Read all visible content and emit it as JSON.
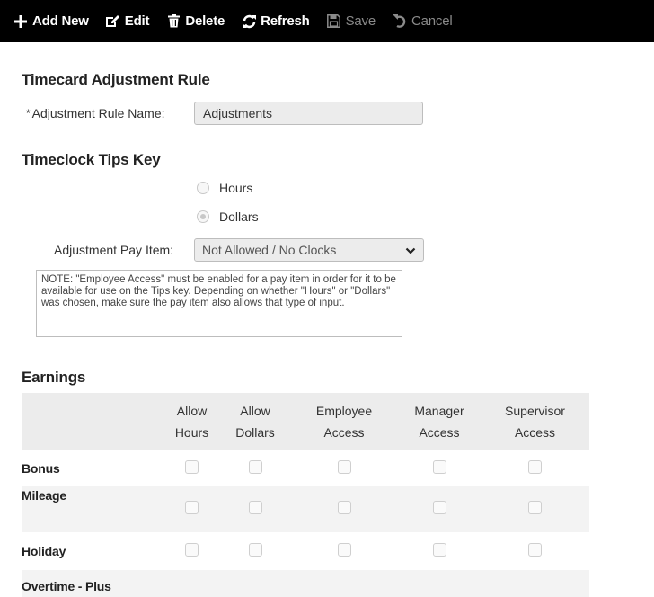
{
  "toolbar": {
    "buttons": [
      {
        "label": "Add New",
        "icon": "plus-icon",
        "enabled": true
      },
      {
        "label": "Edit",
        "icon": "edit-icon",
        "enabled": true
      },
      {
        "label": "Delete",
        "icon": "trash-icon",
        "enabled": true
      },
      {
        "label": "Refresh",
        "icon": "refresh-icon",
        "enabled": true
      },
      {
        "label": "Save",
        "icon": "save-icon",
        "enabled": false
      },
      {
        "label": "Cancel",
        "icon": "undo-icon",
        "enabled": false
      }
    ]
  },
  "rule": {
    "heading": "Timecard Adjustment Rule",
    "required_marker": "*",
    "name_label": "Adjustment Rule Name:",
    "name_value": "Adjustments"
  },
  "tips": {
    "heading": "Timeclock Tips Key",
    "options": [
      {
        "label": "Hours",
        "checked": false
      },
      {
        "label": "Dollars",
        "checked": true
      }
    ],
    "pay_item_label": "Adjustment Pay Item:",
    "pay_item_value": "Not Allowed / No Clocks",
    "note": "NOTE: \"Employee Access\" must be enabled for a pay item in order for it to be available for use on the Tips key. Depending on whether \"Hours\" or \"Dollars\" was chosen, make sure the pay item also allows that type of input."
  },
  "earnings": {
    "heading": "Earnings",
    "columns": [
      {
        "line1": "Allow",
        "line2": "Hours"
      },
      {
        "line1": "Allow",
        "line2": "Dollars"
      },
      {
        "line1": "Employee",
        "line2": "Access"
      },
      {
        "line1": "Manager",
        "line2": "Access"
      },
      {
        "line1": "Supervisor",
        "line2": "Access"
      }
    ],
    "rows": [
      {
        "label": "Bonus"
      },
      {
        "label": "Mileage"
      },
      {
        "label": "Holiday"
      },
      {
        "label": "Overtime - Plus"
      }
    ]
  }
}
